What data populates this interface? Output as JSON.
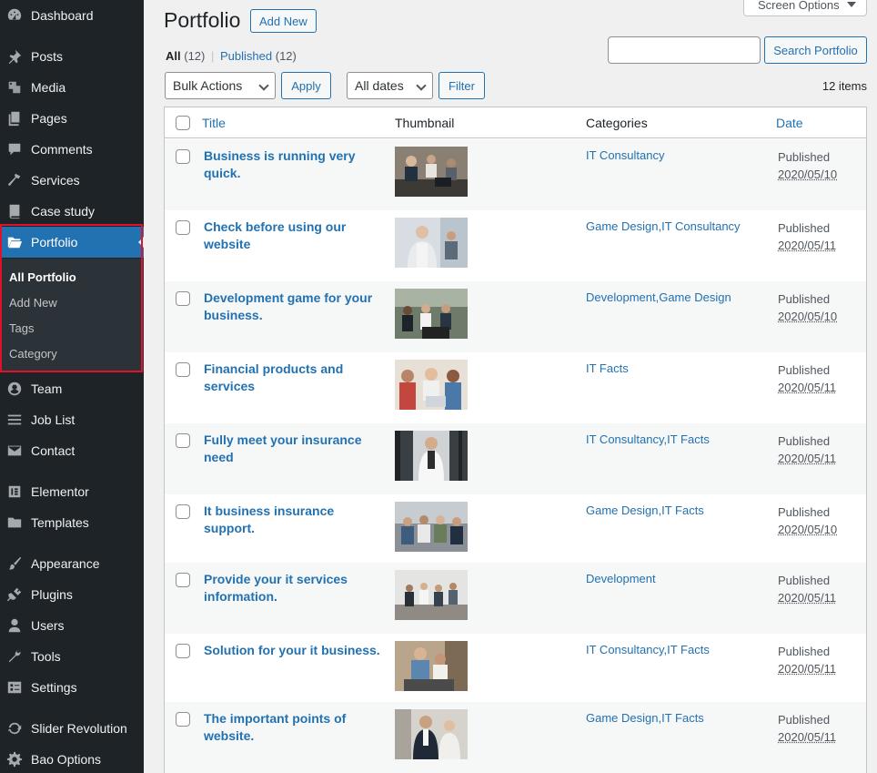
{
  "sidebar": {
    "items": [
      {
        "label": "Dashboard",
        "icon": "dashboard-icon"
      },
      {
        "label": "Posts",
        "icon": "pin-icon"
      },
      {
        "label": "Media",
        "icon": "media-icon"
      },
      {
        "label": "Pages",
        "icon": "pages-icon"
      },
      {
        "label": "Comments",
        "icon": "comment-icon"
      },
      {
        "label": "Services",
        "icon": "hammer-icon"
      },
      {
        "label": "Case study",
        "icon": "book-icon"
      },
      {
        "label": "Portfolio",
        "icon": "folder-open-icon"
      },
      {
        "label": "Team",
        "icon": "user-circle-icon"
      },
      {
        "label": "Job List",
        "icon": "list-icon"
      },
      {
        "label": "Contact",
        "icon": "envelope-icon"
      },
      {
        "label": "Elementor",
        "icon": "elementor-icon"
      },
      {
        "label": "Templates",
        "icon": "folder-icon"
      },
      {
        "label": "Appearance",
        "icon": "brush-icon"
      },
      {
        "label": "Plugins",
        "icon": "plugin-icon"
      },
      {
        "label": "Users",
        "icon": "user-icon"
      },
      {
        "label": "Tools",
        "icon": "wrench-icon"
      },
      {
        "label": "Settings",
        "icon": "settings-icon"
      },
      {
        "label": "Slider Revolution",
        "icon": "refresh-icon"
      },
      {
        "label": "Bao Options",
        "icon": "gear-icon"
      }
    ],
    "submenu": [
      "All Portfolio",
      "Add New",
      "Tags",
      "Category"
    ]
  },
  "header": {
    "screen_options": "Screen Options",
    "title": "Portfolio",
    "add_new": "Add New"
  },
  "views": {
    "all": "All",
    "all_count": "(12)",
    "separator": "|",
    "published": "Published",
    "published_count": "(12)"
  },
  "search": {
    "placeholder": "",
    "button": "Search Portfolio"
  },
  "filters": {
    "bulk_actions": "Bulk Actions",
    "apply": "Apply",
    "all_dates": "All dates",
    "filter": "Filter",
    "items_count": "12 items"
  },
  "table": {
    "headers": {
      "title": "Title",
      "thumbnail": "Thumbnail",
      "categories": "Categories",
      "date": "Date"
    },
    "rows": [
      {
        "title": "Business is running very quick.",
        "categories": "IT Consultancy",
        "status": "Published",
        "date": "2020/05/10"
      },
      {
        "title": "Check before using our website",
        "categories": "Game Design,IT Consultancy",
        "status": "Published",
        "date": "2020/05/11"
      },
      {
        "title": "Development game for your business.",
        "categories": "Development,Game Design",
        "status": "Published",
        "date": "2020/05/10"
      },
      {
        "title": "Financial products and services",
        "categories": "IT Facts",
        "status": "Published",
        "date": "2020/05/11"
      },
      {
        "title": "Fully meet your insurance need",
        "categories": "IT Consultancy,IT Facts",
        "status": "Published",
        "date": "2020/05/11"
      },
      {
        "title": "It business insurance support.",
        "categories": "Game Design,IT Facts",
        "status": "Published",
        "date": "2020/05/10"
      },
      {
        "title": "Provide your it services information.",
        "categories": "Development",
        "status": "Published",
        "date": "2020/05/11"
      },
      {
        "title": "Solution for your it business.",
        "categories": "IT Consultancy,IT Facts",
        "status": "Published",
        "date": "2020/05/11"
      },
      {
        "title": "The important points of website.",
        "categories": "Game Design,IT Facts",
        "status": "Published",
        "date": "2020/05/11"
      }
    ]
  },
  "colors": {
    "accent": "#2271b1",
    "sidebar_bg": "#1d2327",
    "highlight": "#e0112b"
  }
}
